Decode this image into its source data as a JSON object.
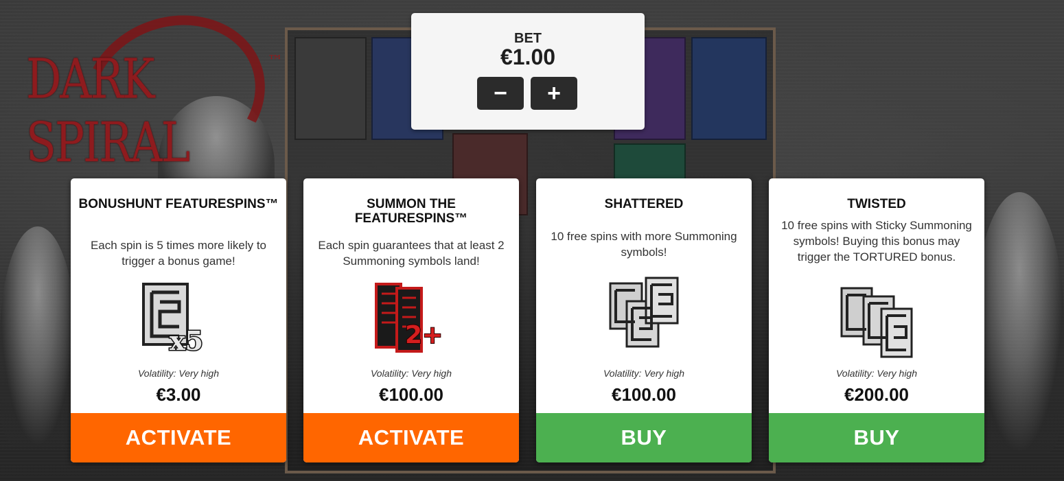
{
  "game": {
    "logo_text": "DARK SPIRAL",
    "logo_tm": "™"
  },
  "bet": {
    "label": "BET",
    "value": "€1.00",
    "decrease_label": "−",
    "increase_label": "+"
  },
  "cards": [
    {
      "title": "BONUSHUNT FEATURESPINS™",
      "description": "Each spin is 5 times more likely to trigger a bonus game!",
      "icon": "summoning-symbol-x5-icon",
      "icon_text": "x5",
      "volatility": "Volatility: Very high",
      "price": "€3.00",
      "button_label": "ACTIVATE",
      "button_color": "#ff6600"
    },
    {
      "title": "SUMMON THE FEATURESPINS™",
      "description": "Each spin guarantees that at least 2 Summoning symbols land!",
      "icon": "red-summoning-scrolls-2plus-icon",
      "icon_text": "2+",
      "volatility": "Volatility: Very high",
      "price": "€100.00",
      "button_label": "ACTIVATE",
      "button_color": "#ff6600"
    },
    {
      "title": "SHATTERED",
      "description": "10 free spins with more Summoning symbols!",
      "icon": "stacked-summoning-symbols-icon",
      "volatility": "Volatility: Very high",
      "price": "€100.00",
      "button_label": "BUY",
      "button_color": "#4cb050"
    },
    {
      "title": "TWISTED",
      "description": "10 free spins with Sticky Summoning symbols! Buying this bonus may trigger the TORTURED bonus.",
      "icon": "triple-summoning-symbols-icon",
      "volatility": "Volatility: Very high",
      "price": "€200.00",
      "button_label": "BUY",
      "button_color": "#4cb050"
    }
  ]
}
